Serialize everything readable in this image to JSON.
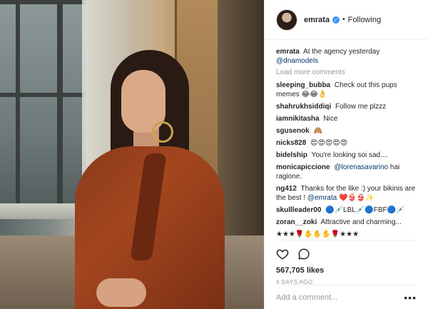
{
  "post": {
    "username": "emrata",
    "follow_status": "Following",
    "separator": "•",
    "caption": {
      "username": "emrata",
      "text": "At the agency yesterday",
      "mention": "@dnamodels"
    },
    "load_more": "Load more comments",
    "comments": [
      {
        "user": "sleeping_bubba",
        "text": "Check out this pups memes 😂😂👌"
      },
      {
        "user": "shahrukhsiddiqi",
        "text": "Follow me plzzz"
      },
      {
        "user": "iamnikitasha",
        "text": "Nice"
      },
      {
        "user": "sgusenok",
        "text": "🙈"
      },
      {
        "user": "nicks828",
        "text": "😍😍😍😍😍"
      },
      {
        "user": "bidelship",
        "text": "You're looking soi sad...."
      },
      {
        "user": "monicapiccione",
        "mention": "@lorenasavarino",
        "text": "hai ragione."
      },
      {
        "user": "ng412",
        "text": "Thanks for the like :) your bikinis are the best !",
        "mention": "@emrata",
        "tail": "❤️👙👙✨"
      },
      {
        "user": "skullleader00",
        "text": "🔵💉LBL💉🔵FBF🔵💉"
      },
      {
        "user": "zoran__zoki",
        "text": "Attractive and charming..."
      },
      {
        "user": "",
        "text": "★★★🌹✋✋✋🌹★★★"
      }
    ],
    "likes": "567,705 likes",
    "timestamp": "4 DAYS AGO",
    "add_comment_placeholder": "Add a comment...",
    "more_label": "•••"
  },
  "icons": {
    "avatar": "profile-avatar",
    "verified": "verified-badge-icon",
    "like": "heart-icon",
    "comment": "comment-icon",
    "more": "more-options-icon"
  },
  "colors": {
    "link": "#003569",
    "muted": "#999999",
    "verified": "#3897f0",
    "text": "#262626"
  }
}
